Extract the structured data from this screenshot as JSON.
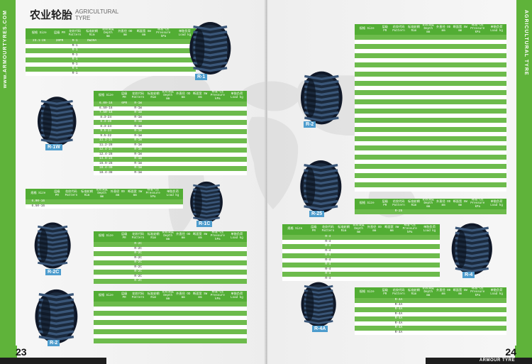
{
  "header": {
    "title_cn": "农业轮胎",
    "title_en": "AGRICULTURAL TYRE"
  },
  "side_strip": {
    "left_text": "www.ARMOURTYRES.COM",
    "right_text": "AGRICULTURAL TYRE"
  },
  "pages": {
    "left_number": "23",
    "right_number": "24",
    "footer_brand": "ARMOUR TYRE"
  },
  "tyre_labels": [
    "R-1",
    "R-1W",
    "R-2",
    "R-1C",
    "R-2C",
    "R-2",
    "R-25",
    "R-4",
    "R-4A"
  ],
  "colors": {
    "brand_green": "#5fb33a",
    "table_header": "#52ad34",
    "stripe": "#6dbb4c",
    "label_blue": "#4d9ccd"
  },
  "tables": {
    "t1": {
      "headers": [
        "规格 Size",
        "层级 PR",
        "花纹代码 Pattern",
        "标准轮辋 Rim",
        "花纹深度 Depth mm",
        "外直径 OD mm",
        "断面宽 SW mm",
        "标准气压 Pressure kPa",
        "单胎负荷 Load kg"
      ],
      "rows": [
        [
          "23.1-26",
          "20PR",
          "R-1",
          "DW20A",
          "",
          "",
          "",
          "",
          ""
        ],
        [
          "",
          "",
          "R-1",
          "",
          "",
          "",
          "",
          "",
          ""
        ],
        [
          "",
          "",
          "R-1",
          "",
          "",
          "",
          "",
          "",
          ""
        ],
        [
          "",
          "",
          "R-1",
          "",
          "",
          "",
          "",
          "",
          ""
        ],
        [
          "",
          "",
          "R-1",
          "",
          "",
          "",
          "",
          "",
          ""
        ],
        [
          "",
          "",
          "R-1",
          "",
          "",
          "",
          "",
          "",
          ""
        ],
        [
          "",
          "",
          "R-1",
          "",
          "",
          "",
          "",
          "",
          ""
        ],
        [
          "",
          "",
          "R-1",
          "",
          "",
          "",
          "",
          "",
          ""
        ]
      ]
    },
    "t2": {
      "headers": [
        "规格 Size",
        "层级 PR",
        "花纹代码 Pattern",
        "标准轮辋 Rim",
        "花纹深度 Depth mm",
        "外直径 OD mm",
        "断面宽 SW mm",
        "标准气压 Pressure kPa",
        "单胎负荷 Load kg"
      ],
      "rows": [
        [
          "6.00-16",
          "6PR",
          "R-1W",
          "",
          "",
          "",
          "",
          "",
          ""
        ],
        [
          "6.50-16",
          "",
          "R-1W",
          "",
          "",
          "",
          "",
          "",
          ""
        ],
        [
          "7.50-16",
          "",
          "R-1W",
          "",
          "",
          "",
          "",
          "",
          ""
        ],
        [
          "8.3-24",
          "",
          "R-1W",
          "",
          "",
          "",
          "",
          "",
          ""
        ],
        [
          "8.3-20",
          "",
          "R-1W",
          "",
          "",
          "",
          "",
          "",
          ""
        ],
        [
          "8.3-24",
          "",
          "R-1W",
          "",
          "",
          "",
          "",
          "",
          ""
        ],
        [
          "9.5-24",
          "",
          "R-1W",
          "",
          "",
          "",
          "",
          "",
          ""
        ],
        [
          "9.5-22",
          "",
          "R-1W",
          "",
          "",
          "",
          "",
          "",
          ""
        ],
        [
          "11.2-24",
          "",
          "R-1W",
          "",
          "",
          "",
          "",
          "",
          ""
        ],
        [
          "11.2-28",
          "",
          "R-1W",
          "",
          "",
          "",
          "",
          "",
          ""
        ],
        [
          "12.4-24",
          "",
          "R-1W",
          "",
          "",
          "",
          "",
          "",
          ""
        ],
        [
          "12.4-28",
          "",
          "R-1W",
          "",
          "",
          "",
          "",
          "",
          ""
        ],
        [
          "14.9-24",
          "",
          "R-1W",
          "",
          "",
          "",
          "",
          "",
          ""
        ],
        [
          "16.9-28",
          "",
          "R-1W",
          "",
          "",
          "",
          "",
          "",
          ""
        ],
        [
          "18.4-30",
          "",
          "R-1W",
          "",
          "",
          "",
          "",
          "",
          ""
        ],
        [
          "18.4-38",
          "",
          "R-1W",
          "",
          "",
          "",
          "",
          "",
          ""
        ]
      ]
    },
    "t3": {
      "headers": [
        "规格 Size",
        "层级 PR",
        "花纹代码 Pattern",
        "标准轮辋 Rim",
        "花纹深度 Depth mm",
        "外直径 OD mm",
        "断面宽 SW mm",
        "标准气压 Pressure kPa",
        "单胎负荷 Load kg"
      ],
      "rows": [
        [
          "6.00-16",
          "",
          "",
          "",
          "",
          "",
          "",
          "",
          ""
        ],
        [
          "6.50-16",
          "",
          "",
          "",
          "",
          "",
          "",
          "",
          ""
        ]
      ]
    },
    "t4": {
      "headers": [
        "规格 Size",
        "层级 PR",
        "花纹代码 Pattern",
        "标准轮辋 Rim",
        "花纹深度 Depth mm",
        "外直径 OD mm",
        "断面宽 SW mm",
        "标准气压 Pressure kPa",
        "单胎负荷 Load kg"
      ],
      "rows": [
        [
          "",
          "",
          "R-2C",
          "",
          "",
          "",
          "",
          "",
          ""
        ],
        [
          "",
          "",
          "R-2C",
          "",
          "",
          "",
          "",
          "",
          ""
        ],
        [
          "",
          "",
          "R-2C",
          "",
          "",
          "",
          "",
          "",
          ""
        ],
        [
          "",
          "",
          "R-2C",
          "",
          "",
          "",
          "",
          "",
          ""
        ],
        [
          "",
          "",
          "R-2C",
          "",
          "",
          "",
          "",
          "",
          ""
        ],
        [
          "",
          "",
          "R-2C",
          "",
          "",
          "",
          "",
          "",
          ""
        ],
        [
          "",
          "",
          "R-2C",
          "",
          "",
          "",
          "",
          "",
          ""
        ],
        [
          "",
          "",
          "R-2C",
          "",
          "",
          "",
          "",
          "",
          ""
        ],
        [
          "",
          "",
          "R-2C",
          "",
          "",
          "",
          "",
          "",
          ""
        ]
      ]
    },
    "t5": {
      "headers": [
        "规格 Size",
        "层级 PR",
        "花纹代码 Pattern",
        "标准轮辋 Rim",
        "花纹深度 Depth mm",
        "外直径 OD mm",
        "断面宽 SW mm",
        "标准气压 Pressure kPa",
        "单胎负荷 Load kg"
      ],
      "rows": [
        [
          "",
          "",
          "",
          "",
          "",
          "",
          "",
          "",
          ""
        ],
        [
          "",
          "",
          "",
          "",
          "",
          "",
          "",
          "",
          ""
        ],
        [
          "",
          "",
          "",
          "",
          "",
          "",
          "",
          "",
          ""
        ],
        [
          "",
          "",
          "",
          "",
          "",
          "",
          "",
          "",
          ""
        ],
        [
          "",
          "",
          "",
          "",
          "",
          "",
          "",
          "",
          ""
        ],
        [
          "",
          "",
          "",
          "",
          "",
          "",
          "",
          "",
          ""
        ],
        [
          "",
          "",
          "",
          "",
          "",
          "",
          "",
          "",
          ""
        ],
        [
          "",
          "",
          "",
          "",
          "",
          "",
          "",
          "",
          ""
        ],
        [
          "",
          "",
          "",
          "",
          "",
          "",
          "",
          "",
          ""
        ]
      ]
    },
    "t6": {
      "headers": [
        "规格 Size",
        "层级 PR",
        "花纹代码 Pattern",
        "标准轮辋 Rim",
        "花纹深度 Depth mm",
        "外直径 OD mm",
        "断面宽 SW mm",
        "标准气压 Pressure kPa",
        "单胎负荷 Load kg"
      ],
      "rows": [
        [
          "",
          "",
          "",
          "",
          "",
          "",
          "",
          "",
          ""
        ],
        [
          "",
          "",
          "",
          "",
          "",
          "",
          "",
          "",
          ""
        ],
        [
          "",
          "",
          "",
          "",
          "",
          "",
          "",
          "",
          ""
        ],
        [
          "",
          "",
          "",
          "",
          "",
          "",
          "",
          "",
          ""
        ],
        [
          "",
          "",
          "",
          "",
          "",
          "",
          "",
          "",
          ""
        ],
        [
          "",
          "",
          "",
          "",
          "",
          "",
          "",
          "",
          ""
        ],
        [
          "",
          "",
          "",
          "",
          "",
          "",
          "",
          "",
          ""
        ],
        [
          "",
          "",
          "",
          "",
          "",
          "",
          "",
          "",
          ""
        ],
        [
          "",
          "",
          "",
          "",
          "",
          "",
          "",
          "",
          ""
        ],
        [
          "",
          "",
          "",
          "",
          "",
          "",
          "",
          "",
          ""
        ],
        [
          "",
          "",
          "",
          "",
          "",
          "",
          "",
          "",
          ""
        ],
        [
          "",
          "",
          "",
          "",
          "",
          "",
          "",
          "",
          ""
        ],
        [
          "",
          "",
          "",
          "",
          "",
          "",
          "",
          "",
          ""
        ],
        [
          "",
          "",
          "",
          "",
          "",
          "",
          "",
          "",
          ""
        ],
        [
          "",
          "",
          "",
          "",
          "",
          "",
          "",
          "",
          ""
        ],
        [
          "",
          "",
          "",
          "",
          "",
          "",
          "",
          "",
          ""
        ],
        [
          "",
          "",
          "",
          "",
          "",
          "",
          "",
          "",
          ""
        ],
        [
          "",
          "",
          "",
          "",
          "",
          "",
          "",
          "",
          ""
        ],
        [
          "",
          "",
          "",
          "",
          "",
          "",
          "",
          "",
          ""
        ],
        [
          "",
          "",
          "",
          "",
          "",
          "",
          "",
          "",
          ""
        ],
        [
          "",
          "",
          "",
          "",
          "",
          "",
          "",
          "",
          ""
        ],
        [
          "",
          "",
          "",
          "",
          "",
          "",
          "",
          "",
          ""
        ],
        [
          "",
          "",
          "",
          "",
          "",
          "",
          "",
          "",
          ""
        ],
        [
          "",
          "",
          "",
          "",
          "",
          "",
          "",
          "",
          ""
        ],
        [
          "",
          "",
          "",
          "",
          "",
          "",
          "",
          "",
          ""
        ],
        [
          "",
          "",
          "",
          "",
          "",
          "",
          "",
          "",
          ""
        ],
        [
          "",
          "",
          "",
          "",
          "",
          "",
          "",
          "",
          ""
        ],
        [
          "",
          "",
          "",
          "",
          "",
          "",
          "",
          "",
          ""
        ],
        [
          "",
          "",
          "",
          "",
          "",
          "",
          "",
          "",
          ""
        ],
        [
          "",
          "",
          "",
          "",
          "",
          "",
          "",
          "",
          ""
        ],
        [
          "",
          "",
          "",
          "",
          "",
          "",
          "",
          "",
          ""
        ],
        [
          "",
          "",
          "",
          "",
          "",
          "",
          "",
          "",
          ""
        ],
        [
          "",
          "",
          "",
          "",
          "",
          "",
          "",
          "",
          ""
        ],
        [
          "",
          "",
          "",
          "",
          "",
          "",
          "",
          "",
          ""
        ]
      ]
    },
    "t7": {
      "headers": [
        "规格 Size",
        "层级 PR",
        "花纹代码 Pattern",
        "标准轮辋 Rim",
        "花纹深度 Depth mm",
        "外直径 OD mm",
        "断面宽 SW mm",
        "标准气压 Pressure kPa",
        "单胎负荷 Load kg"
      ],
      "rows": [
        [
          "",
          "",
          "R-25",
          "",
          "",
          "",
          "",
          "",
          ""
        ]
      ]
    },
    "t8": {
      "headers": [
        "规格 Size",
        "层级 PR",
        "花纹代码 Pattern",
        "标准轮辋 Rim",
        "花纹深度 Depth mm",
        "外直径 OD mm",
        "断面宽 SW mm",
        "标准气压 Pressure kPa",
        "单胎负荷 Load kg"
      ],
      "rows": [
        [
          "",
          "",
          "R-4",
          "",
          "",
          "",
          "",
          "",
          ""
        ],
        [
          "",
          "",
          "R-4",
          "",
          "",
          "",
          "",
          "",
          ""
        ],
        [
          "",
          "",
          "R-4",
          "",
          "",
          "",
          "",
          "",
          ""
        ],
        [
          "",
          "",
          "R-4",
          "",
          "",
          "",
          "",
          "",
          ""
        ],
        [
          "",
          "",
          "R-4",
          "",
          "",
          "",
          "",
          "",
          ""
        ],
        [
          "",
          "",
          "R-4",
          "",
          "",
          "",
          "",
          "",
          ""
        ],
        [
          "",
          "",
          "R-4",
          "",
          "",
          "",
          "",
          "",
          ""
        ],
        [
          "",
          "",
          "R-4",
          "",
          "",
          "",
          "",
          "",
          ""
        ],
        [
          "",
          "",
          "R-4",
          "",
          "",
          "",
          "",
          "",
          ""
        ],
        [
          "",
          "",
          "R-4",
          "",
          "",
          "",
          "",
          "",
          ""
        ]
      ]
    },
    "t9": {
      "headers": [
        "规格 Size",
        "层级 PR",
        "花纹代码 Pattern",
        "标准轮辋 Rim",
        "花纹深度 Depth mm",
        "外直径 OD mm",
        "断面宽 SW mm",
        "标准气压 Pressure kPa",
        "单胎负荷 Load kg"
      ],
      "rows": [
        [
          "",
          "",
          "R-4A",
          "",
          "",
          "",
          "",
          "",
          ""
        ],
        [
          "",
          "",
          "R-4A",
          "",
          "",
          "",
          "",
          "",
          ""
        ],
        [
          "",
          "",
          "R-4A",
          "",
          "",
          "",
          "",
          "",
          ""
        ],
        [
          "",
          "",
          "R-4A",
          "",
          "",
          "",
          "",
          "",
          ""
        ],
        [
          "",
          "",
          "R-4A",
          "",
          "",
          "",
          "",
          "",
          ""
        ],
        [
          "",
          "",
          "R-4A",
          "",
          "",
          "",
          "",
          "",
          ""
        ],
        [
          "",
          "",
          "R-4A",
          "",
          "",
          "",
          "",
          "",
          ""
        ],
        [
          "",
          "",
          "R-4A",
          "",
          "",
          "",
          "",
          "",
          ""
        ]
      ]
    }
  }
}
